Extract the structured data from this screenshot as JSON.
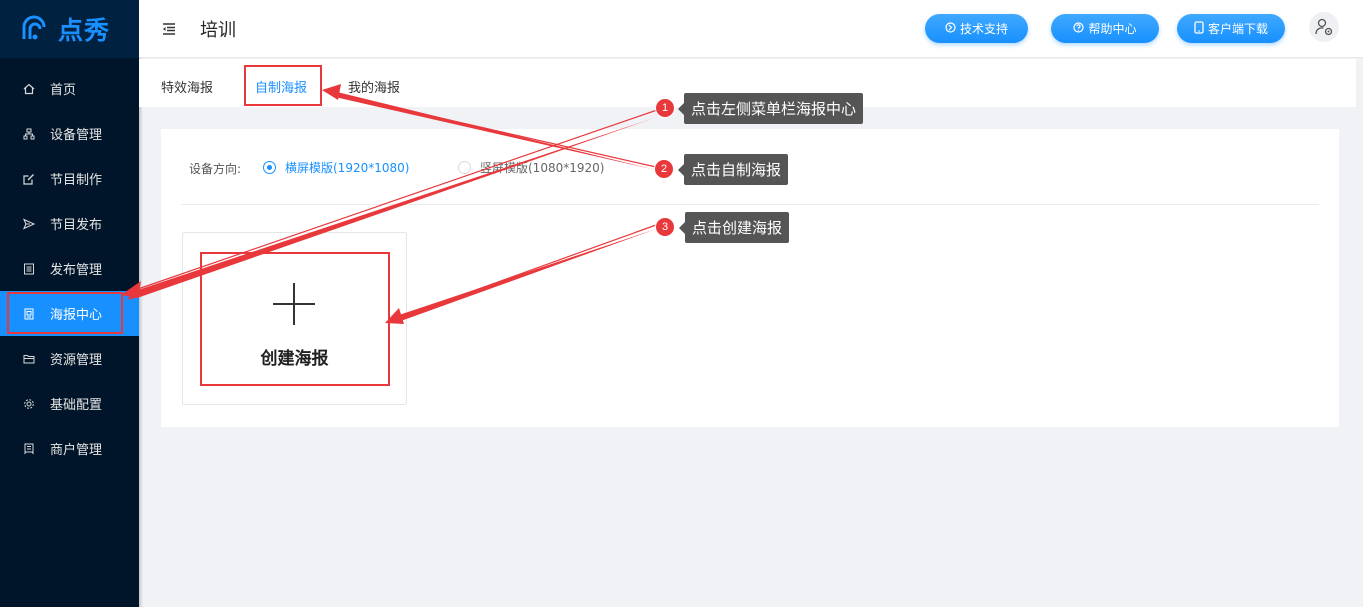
{
  "app": {
    "logo_text": "点秀",
    "accent": "#1890ff",
    "sidebar_bg": "#001529"
  },
  "sidebar": {
    "items": [
      {
        "label": "首页",
        "icon": "home-icon",
        "active": false
      },
      {
        "label": "设备管理",
        "icon": "device-icon",
        "active": false
      },
      {
        "label": "节目制作",
        "icon": "edit-icon",
        "active": false
      },
      {
        "label": "节目发布",
        "icon": "send-icon",
        "active": false
      },
      {
        "label": "发布管理",
        "icon": "list-icon",
        "active": false
      },
      {
        "label": "海报中心",
        "icon": "poster-icon",
        "active": true
      },
      {
        "label": "资源管理",
        "icon": "folder-icon",
        "active": false
      },
      {
        "label": "基础配置",
        "icon": "gear-icon",
        "active": false
      },
      {
        "label": "商户管理",
        "icon": "merchant-icon",
        "active": false
      }
    ]
  },
  "header": {
    "title": "培训",
    "buttons": [
      {
        "label": "技术支持",
        "icon": "support-icon"
      },
      {
        "label": "帮助中心",
        "icon": "help-icon"
      },
      {
        "label": "客户端下载",
        "icon": "mobile-icon"
      }
    ]
  },
  "tabs": [
    {
      "label": "特效海报",
      "active": false
    },
    {
      "label": "自制海报",
      "active": true
    },
    {
      "label": "我的海报",
      "active": false
    }
  ],
  "orientation": {
    "label": "设备方向:",
    "options": [
      {
        "label": "横屏模版(1920*1080)",
        "checked": true
      },
      {
        "label": "竖屏模版(1080*1920)",
        "checked": false
      }
    ]
  },
  "create_tile": {
    "label": "创建海报"
  },
  "annotations": [
    {
      "number": "1",
      "text": "点击左侧菜单栏海报中心"
    },
    {
      "number": "2",
      "text": "点击自制海报"
    },
    {
      "number": "3",
      "text": "点击创建海报"
    }
  ],
  "annotation_color": "#e8383b"
}
